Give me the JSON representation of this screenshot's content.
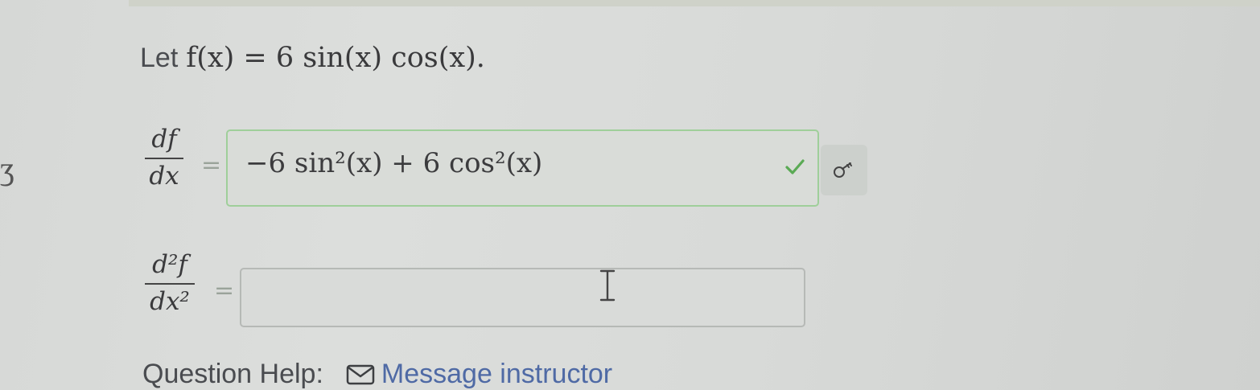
{
  "problem": {
    "let_text": "Let",
    "function_expression": "f(x) = 6 sin(x) cos(x)."
  },
  "first_derivative": {
    "numerator": "df",
    "denominator": "dx",
    "equals": "=",
    "answer_value": "−6 sin²(x) + 6 cos²(x)",
    "status_icon": "checkmark-icon",
    "status_color": "#5aaa54",
    "tool_icon": "key-icon"
  },
  "second_derivative": {
    "numerator": "d²f",
    "denominator": "dx²",
    "equals": "=",
    "answer_value": ""
  },
  "help": {
    "label": "Question Help:",
    "link_text": "Message instructor",
    "link_icon": "mail-icon",
    "link_color": "#4f6aa5"
  }
}
